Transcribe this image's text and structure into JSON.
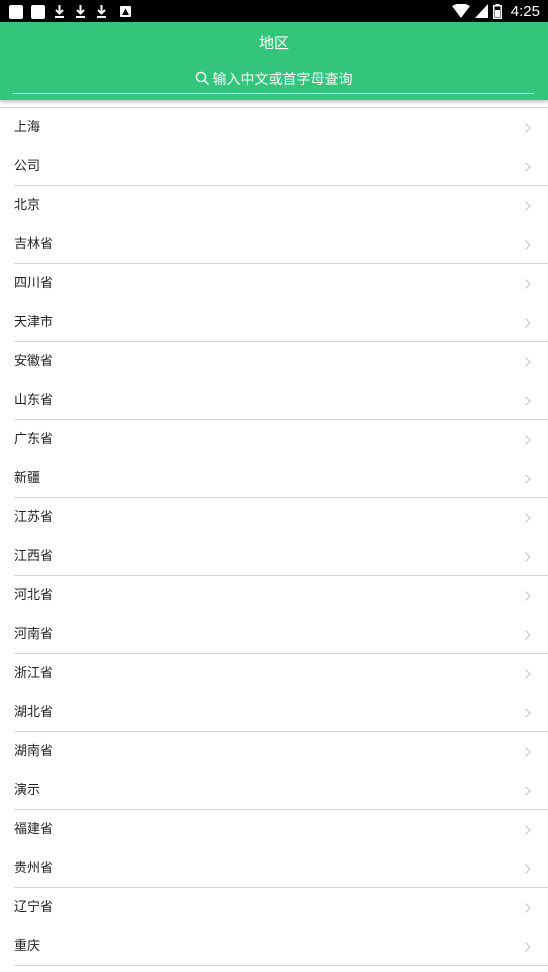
{
  "status_bar": {
    "time": "4:25",
    "icons": [
      "square-notification-icon",
      "square-notification-icon",
      "download-icon",
      "download-icon",
      "download-icon",
      "picture-icon",
      "wifi-icon",
      "cell-signal-icon",
      "battery-icon"
    ]
  },
  "header": {
    "title": "地区",
    "search_placeholder": "输入中文或首字母查询"
  },
  "colors": {
    "header_bg": "#33c57c",
    "divider": "#d6d6d6",
    "chevron": "#c8c8c8"
  },
  "regions": [
    "上海",
    "公司",
    "北京",
    "吉林省",
    "四川省",
    "天津市",
    "安徽省",
    "山东省",
    "广东省",
    "新疆",
    "江苏省",
    "江西省",
    "河北省",
    "河南省",
    "浙江省",
    "湖北省",
    "湖南省",
    "演示",
    "福建省",
    "贵州省",
    "辽宁省",
    "重庆"
  ]
}
